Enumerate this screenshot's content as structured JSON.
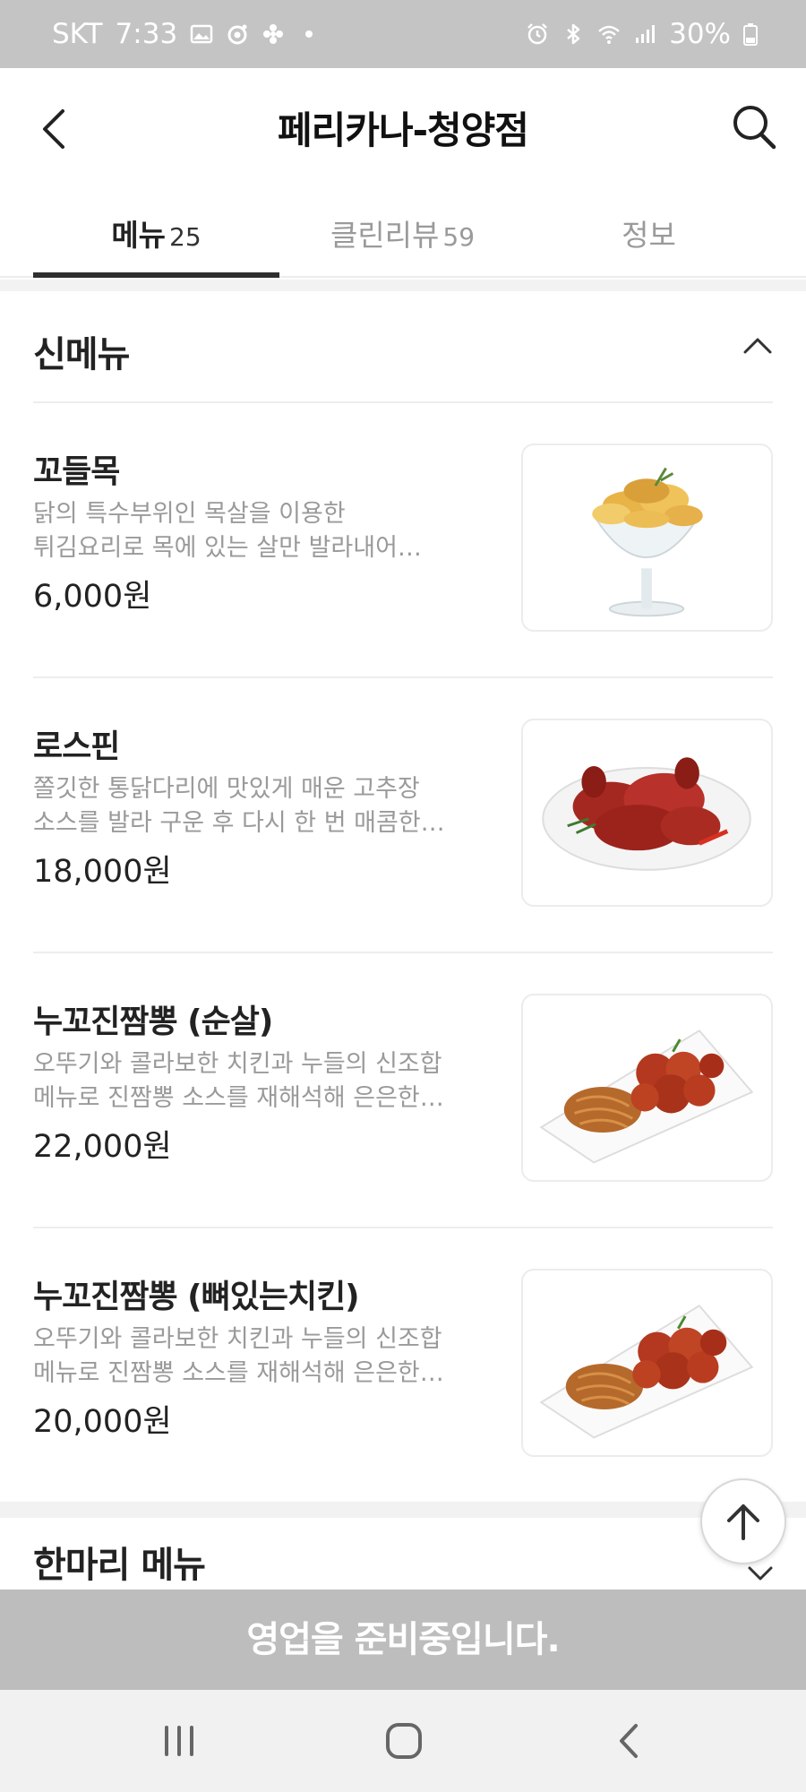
{
  "status_bar": {
    "carrier": "SKT",
    "time": "7:33",
    "battery": "30%",
    "left_icons": [
      "image-icon",
      "record-icon",
      "fan-icon",
      "dot-icon"
    ],
    "right_icons": [
      "alarm-icon",
      "bluetooth-icon",
      "wifi-icon",
      "signal-icon",
      "battery-icon"
    ]
  },
  "header": {
    "title": "페리카나-청양점",
    "back_icon": "back-arrow-icon",
    "search_icon": "search-icon"
  },
  "tabs": [
    {
      "label": "메뉴",
      "count": "25",
      "active": true
    },
    {
      "label": "클린리뷰",
      "count": "59",
      "active": false
    },
    {
      "label": "정보",
      "count": "",
      "active": false
    }
  ],
  "section": {
    "title": "신메뉴",
    "toggle_icon": "chevron-up-icon"
  },
  "menu_items": [
    {
      "name": "꼬들목",
      "desc_line1": "닭의 특수부위인 목살을 이용한",
      "desc_line2": "튀김요리로 목에 있는 살만 발라내어…",
      "price": "6,000원",
      "image": "fried-neck-in-glass"
    },
    {
      "name": "로스핀",
      "desc_line1": "쫄깃한 통닭다리에 맛있게 매운 고추장",
      "desc_line2": "소스를 발라 구운 후 다시 한 번 매콤한…",
      "price": "18,000원",
      "image": "red-glazed-drumsticks"
    },
    {
      "name": "누꼬진짬뽕 (순살)",
      "desc_line1": "오뚜기와 콜라보한 치킨과 누들의 신조합",
      "desc_line2": "메뉴로 진짬뽕 소스를 재해석해 은은한…",
      "price": "22,000원",
      "image": "chicken-with-noodles"
    },
    {
      "name": "누꼬진짬뽕 (뼈있는치킨)",
      "desc_line1": "오뚜기와 콜라보한 치킨과 누들의 신조합",
      "desc_line2": "메뉴로 진짬뽕 소스를 재해석해 은은한…",
      "price": "20,000원",
      "image": "chicken-with-noodles"
    }
  ],
  "next_section": {
    "title": "한마리 메뉴",
    "toggle_icon": "chevron-down-icon"
  },
  "scroll_top_icon": "arrow-up-icon",
  "closed_banner": "영업을 준비중입니다.",
  "nav_bar": {
    "icons": [
      "recent-apps-icon",
      "home-icon",
      "back-icon"
    ]
  },
  "colors": {
    "status_bar_bg": "#c4c4c4",
    "banner_bg": "#bdbdbd",
    "active_tab_underline": "#2f2f2f",
    "desc_text": "#9a9a9a"
  }
}
